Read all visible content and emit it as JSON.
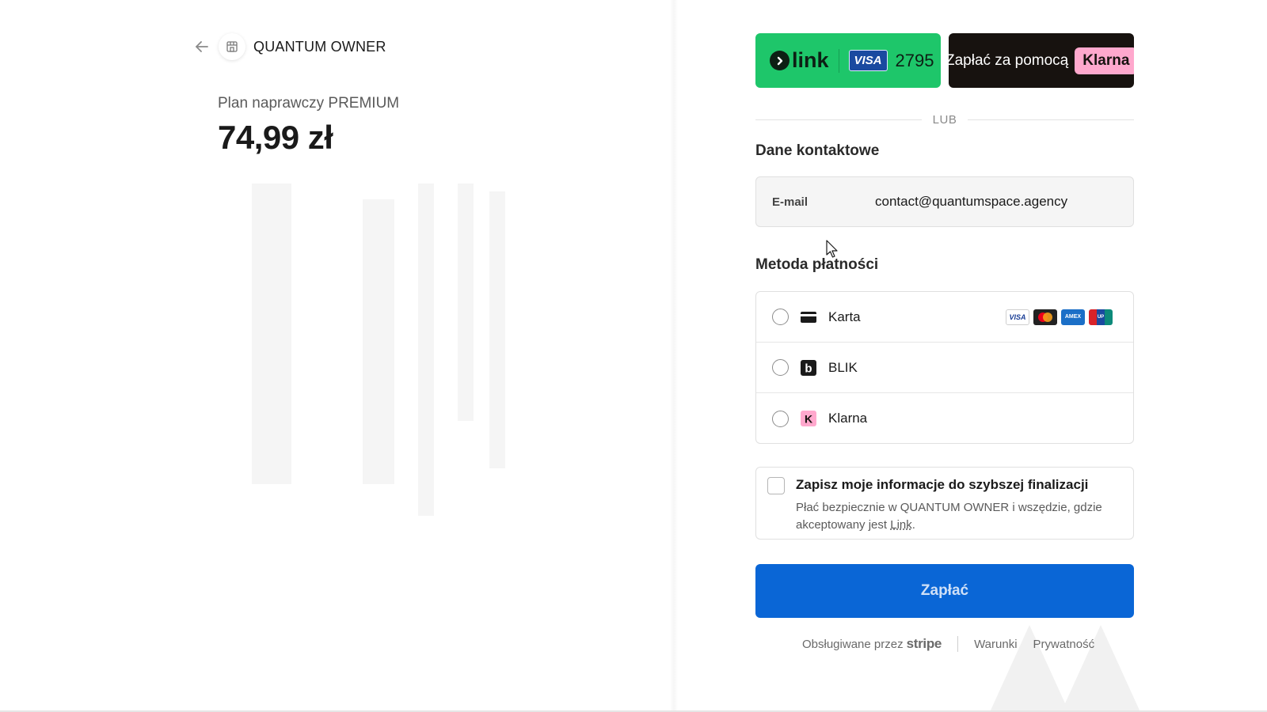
{
  "header": {
    "store_name": "QUANTUM OWNER",
    "back_icon": "arrow-left-icon",
    "store_icon": "store-icon"
  },
  "product": {
    "name": "Plan naprawczy PREMIUM",
    "price": "74,99 zł"
  },
  "express": {
    "link_word": "link",
    "link_card_brand": "VISA",
    "link_card_last4": "2795",
    "klarna_text": "Zapłać za pomocą",
    "klarna_brand": "Klarna",
    "link_color": "#1ec66a",
    "klarna_color": "#17120f"
  },
  "divider_text": "LUB",
  "contact": {
    "title": "Dane kontaktowe",
    "email_label": "E-mail",
    "email_value": "contact@quantumspace.agency"
  },
  "payment_method": {
    "title": "Metoda płatności",
    "options": [
      {
        "label": "Karta",
        "icon": "credit-card-icon"
      },
      {
        "label": "BLIK",
        "icon": "blik-icon"
      },
      {
        "label": "Klarna",
        "icon": "klarna-icon"
      }
    ],
    "card_brands": [
      "visa",
      "mastercard",
      "amex",
      "unionpay"
    ]
  },
  "save_info": {
    "title": "Zapisz moje informacje do szybszej finalizacji",
    "desc_prefix": "Płać bezpiecznie w QUANTUM OWNER i wszędzie, gdzie akceptowany jest ",
    "desc_link": "Link",
    "desc_suffix": "."
  },
  "pay_button": {
    "label": "Zapłać",
    "color": "#0a66d6"
  },
  "footer": {
    "powered_by": "Obsługiwane przez",
    "stripe": "stripe",
    "terms": "Warunki",
    "privacy": "Prywatność"
  }
}
